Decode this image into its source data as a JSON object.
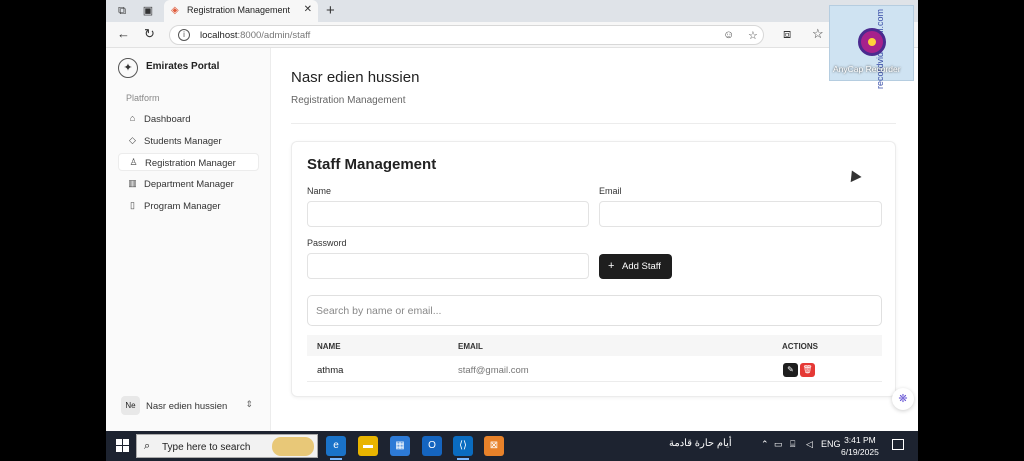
{
  "browser": {
    "tab_title": "Registration Management",
    "url_host": "localhost",
    "url_path": ":8000/admin/staff",
    "new_tab_glyph": "+",
    "close_glyph": "✕"
  },
  "sidebar": {
    "brand": "Emirates Portal",
    "section": "Platform",
    "items": [
      {
        "label": "Dashboard",
        "icon": "home-icon"
      },
      {
        "label": "Students Manager",
        "icon": "graduation-cap-icon"
      },
      {
        "label": "Registration Manager",
        "icon": "user-icon",
        "active": true
      },
      {
        "label": "Department Manager",
        "icon": "building-icon"
      },
      {
        "label": "Program Manager",
        "icon": "book-icon"
      }
    ],
    "user": {
      "initials": "Ne",
      "name": "Nasr edien hussien"
    }
  },
  "header": {
    "title": "Nasr edien hussien",
    "subtitle": "Registration Management"
  },
  "staff": {
    "title": "Staff Management",
    "name_label": "Name",
    "email_label": "Email",
    "password_label": "Password",
    "add_button": "Add Staff",
    "search_placeholder": "Search by name or email...",
    "columns": [
      "NAME",
      "EMAIL",
      "ACTIONS"
    ],
    "rows": [
      {
        "name": "athma",
        "email": "staff@gmail.com"
      }
    ]
  },
  "watermark": {
    "vertical": "recordvideocall.com",
    "label": "AnyCap Recorder"
  },
  "taskbar": {
    "search_text": "Type here to search",
    "weather": "أيام حارة قادمة",
    "lang": "ENG",
    "time": "3:41 PM",
    "date": "6/19/2025"
  },
  "colors": {
    "accent": "#1e1e1e",
    "edit": "#1e1e1e",
    "delete": "#e53935"
  }
}
